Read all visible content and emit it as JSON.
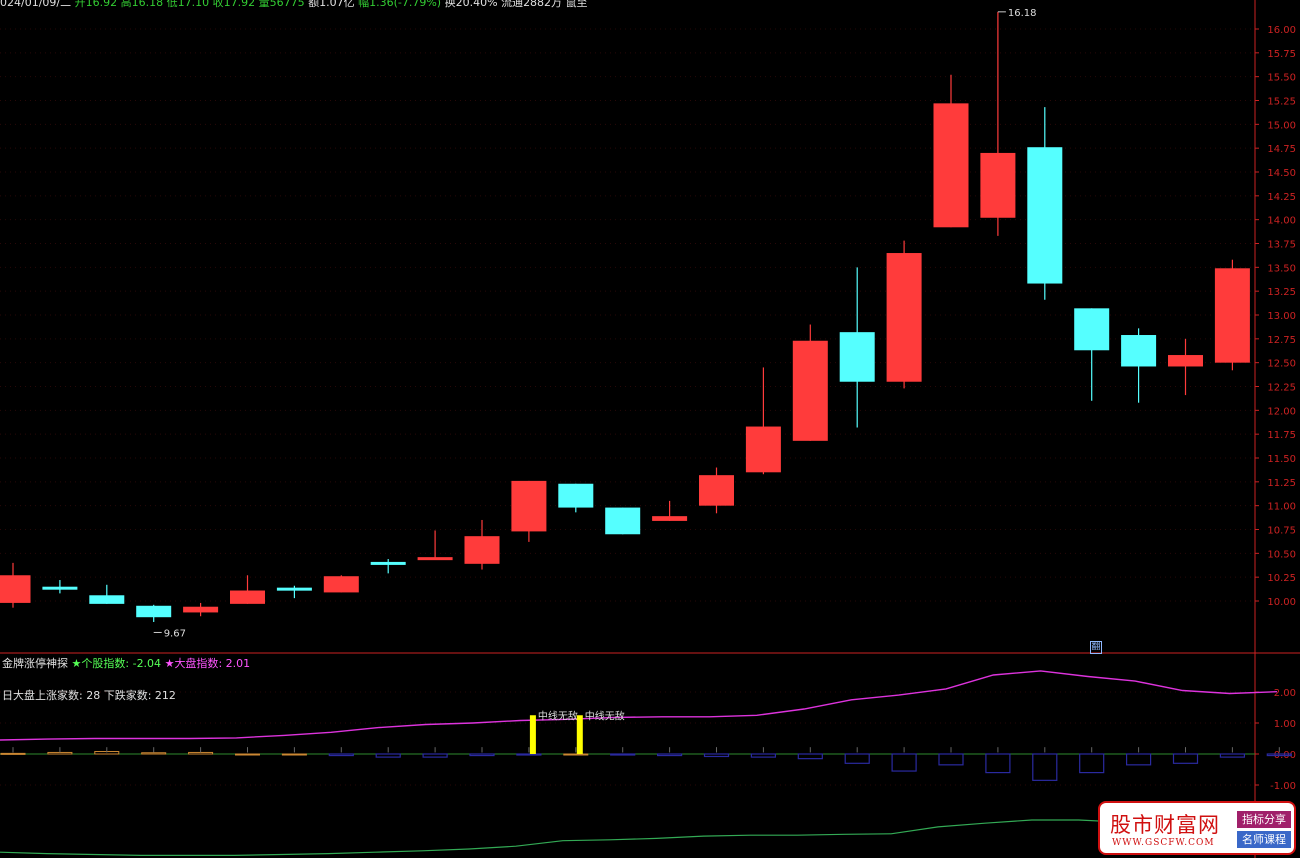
{
  "header": {
    "date": "024/01/09/二",
    "items": [
      {
        "label": "开",
        "value": "16.92"
      },
      {
        "label": "高",
        "value": "16.18"
      },
      {
        "label": "低",
        "value": "17.10"
      },
      {
        "label": "收",
        "value": "17.92"
      },
      {
        "label": "量",
        "value": "56775"
      },
      {
        "label": "额",
        "value": "1.07亿"
      },
      {
        "label": "幅",
        "value": "1.36(-7.79%)"
      },
      {
        "label": "换",
        "value": "20.40%"
      },
      {
        "label": "流通",
        "value": "2882万"
      },
      {
        "label": "",
        "value": "鼠至"
      }
    ]
  },
  "indicator": {
    "name": "金牌涨停神探",
    "stock_index_label": "个股指数",
    "stock_index_value": "-2.04",
    "market_index_label": "大盘指数",
    "market_index_value": "2.01",
    "note": "日大盘上涨家数: 28 下跌家数: 212",
    "signal_text": "中线无敌"
  },
  "mark_glyph": "翻",
  "colors": {
    "up": "#ff3b3b",
    "down": "#55ffff",
    "axis": "#cc2222",
    "magenta": "#dd33dd",
    "green_line": "#33aa55",
    "signal": "#ffff00",
    "histogram": "#2a2aa0"
  },
  "logo": {
    "name": "股市财富网",
    "url": "WWW.GSCFW.COM",
    "tag1": "指标分享",
    "tag2": "名师课程"
  },
  "chart_data": [
    {
      "type": "candlestick",
      "title": "",
      "y_ticks": [
        "16.00",
        "15.75",
        "15.50",
        "15.25",
        "15.00",
        "14.75",
        "14.50",
        "14.25",
        "14.00",
        "13.75",
        "13.50",
        "13.25",
        "13.00",
        "12.75",
        "12.50",
        "12.25",
        "12.00",
        "11.75",
        "11.50",
        "11.25",
        "11.00",
        "10.75",
        "10.50",
        "10.25",
        "10.00"
      ],
      "ylim": [
        9.7,
        16.3
      ],
      "annotations": [
        {
          "text": "16.18",
          "candle": 21,
          "value": 16.18
        },
        {
          "text": "9.67",
          "candle": 3,
          "value": 9.67
        }
      ],
      "candles": [
        {
          "open": 9.98,
          "close": 10.27,
          "high": 10.4,
          "low": 9.93
        },
        {
          "open": 10.15,
          "close": 10.12,
          "high": 10.22,
          "low": 10.08
        },
        {
          "open": 10.06,
          "close": 9.97,
          "high": 10.17,
          "low": 9.97
        },
        {
          "open": 9.95,
          "close": 9.83,
          "high": 9.96,
          "low": 9.78
        },
        {
          "open": 9.88,
          "close": 9.94,
          "high": 9.98,
          "low": 9.84
        },
        {
          "open": 9.97,
          "close": 10.11,
          "high": 10.27,
          "low": 9.97
        },
        {
          "open": 10.14,
          "close": 10.13,
          "high": 10.16,
          "low": 10.03
        },
        {
          "open": 10.09,
          "close": 10.26,
          "high": 10.27,
          "low": 10.09
        },
        {
          "open": 10.41,
          "close": 10.38,
          "high": 10.44,
          "low": 10.29
        },
        {
          "open": 10.43,
          "close": 10.46,
          "high": 10.74,
          "low": 10.43
        },
        {
          "open": 10.39,
          "close": 10.68,
          "high": 10.85,
          "low": 10.33
        },
        {
          "open": 10.73,
          "close": 11.26,
          "high": 11.26,
          "low": 10.62
        },
        {
          "open": 11.23,
          "close": 10.98,
          "high": 11.23,
          "low": 10.93
        },
        {
          "open": 10.98,
          "close": 10.7,
          "high": 10.98,
          "low": 10.7
        },
        {
          "open": 10.84,
          "close": 10.89,
          "high": 11.05,
          "low": 10.84
        },
        {
          "open": 11.0,
          "close": 11.32,
          "high": 11.4,
          "low": 10.92
        },
        {
          "open": 11.35,
          "close": 11.83,
          "high": 12.45,
          "low": 11.33
        },
        {
          "open": 11.68,
          "close": 12.73,
          "high": 12.9,
          "low": 11.68
        },
        {
          "open": 12.82,
          "close": 12.3,
          "high": 13.5,
          "low": 11.82
        },
        {
          "open": 12.3,
          "close": 13.65,
          "high": 13.78,
          "low": 12.23
        },
        {
          "open": 13.92,
          "close": 15.22,
          "high": 15.52,
          "low": 13.92
        },
        {
          "open": 14.02,
          "close": 14.7,
          "high": 16.18,
          "low": 13.83
        },
        {
          "open": 14.76,
          "close": 13.33,
          "high": 15.18,
          "low": 13.16
        },
        {
          "open": 13.07,
          "close": 12.63,
          "high": 13.07,
          "low": 12.1
        },
        {
          "open": 12.79,
          "close": 12.46,
          "high": 12.86,
          "low": 12.08
        },
        {
          "open": 12.46,
          "close": 12.58,
          "high": 12.75,
          "low": 12.16
        },
        {
          "open": 12.5,
          "close": 13.49,
          "high": 13.58,
          "low": 12.42
        }
      ]
    },
    {
      "type": "line",
      "title": "",
      "y_ticks": [
        "2.00",
        "1.00",
        "0.00",
        "-1.00"
      ],
      "ylim": [
        -1.6,
        3.3
      ],
      "magenta_line": [
        0.45,
        0.48,
        0.5,
        0.5,
        0.5,
        0.52,
        0.6,
        0.7,
        0.85,
        0.95,
        1.0,
        1.08,
        1.12,
        1.18,
        1.2,
        1.2,
        1.25,
        1.45,
        1.75,
        1.9,
        2.1,
        2.55,
        2.68,
        2.5,
        2.35,
        2.05,
        1.95,
        2.01
      ],
      "histogram": [
        0.02,
        0.05,
        0.08,
        0.04,
        0.05,
        0.0,
        0.0,
        -0.05,
        -0.1,
        -0.1,
        -0.05,
        -0.02,
        0.0,
        -0.03,
        -0.05,
        -0.08,
        -0.1,
        -0.15,
        -0.3,
        -0.55,
        -0.35,
        -0.6,
        -0.85,
        -0.6,
        -0.35,
        -0.3,
        -0.1,
        -0.05,
        -0.35
      ],
      "signals": [
        {
          "candle": 11,
          "label": "中线无敌"
        },
        {
          "candle": 12,
          "label": "中线无敌"
        }
      ],
      "green_line": [
        -2.75,
        -2.78,
        -2.8,
        -2.82,
        -2.82,
        -2.82,
        -2.8,
        -2.78,
        -2.75,
        -2.72,
        -2.68,
        -2.62,
        -2.5,
        -2.48,
        -2.45,
        -2.4,
        -2.38,
        -2.38,
        -2.36,
        -2.35,
        -2.2,
        -2.12,
        -2.05,
        -2.05,
        -2.1,
        -2.2,
        -2.3,
        -2.35
      ]
    }
  ]
}
